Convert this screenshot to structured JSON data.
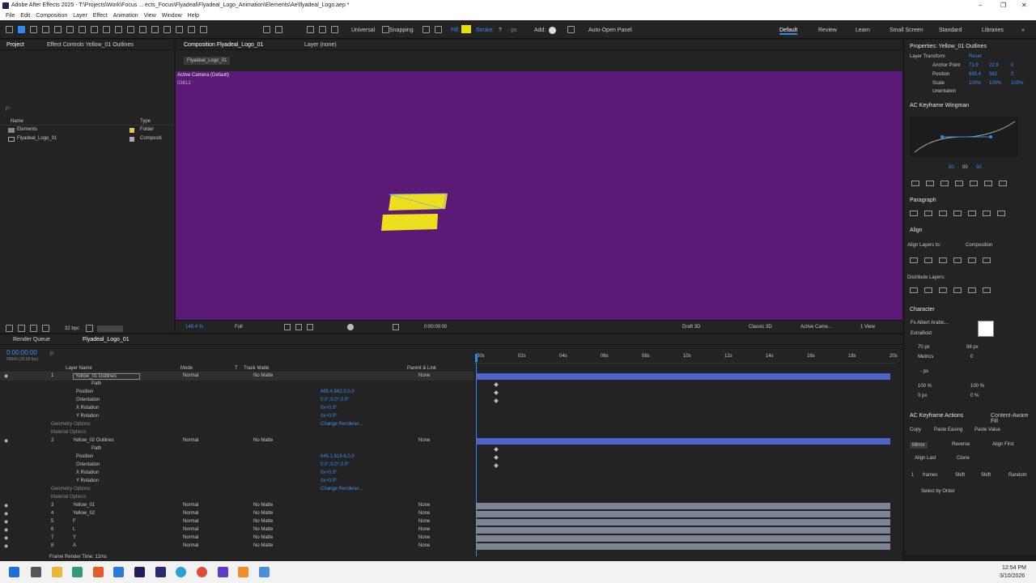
{
  "window": {
    "title": "Adobe After Effects 2025 - T:\\Projects\\Work\\Focus ... ects_Focus\\Flyadeal\\Flyadeal_Logo_Animation\\Elements\\Ae\\flyadeal_Logo.aep *"
  },
  "menu": [
    "File",
    "Edit",
    "Composition",
    "Layer",
    "Effect",
    "Animation",
    "View",
    "Window",
    "Help"
  ],
  "toolbar": {
    "universal": "Universal",
    "snapping": "Snapping",
    "fill": "Fill:",
    "stroke": "Stroke:",
    "stroke_val": "?",
    "px": "- px",
    "add": "Add:",
    "auto_open": "Auto-Open Panel",
    "fill_color": "#e8e000",
    "accent": "#2d8ceb"
  },
  "workspaces": [
    "Default",
    "Review",
    "Learn",
    "Small Screen",
    "Standard",
    "Libraries"
  ],
  "project": {
    "tab": "Project",
    "effect_tab": "Effect Controls Yellow_01 Outlines",
    "search": "ρ~",
    "col_name": "Name",
    "col_type": "Type",
    "items": [
      {
        "name": "Elements",
        "type": "Folder"
      },
      {
        "name": "Flyadeal_Logo_01",
        "type": "Compositi"
      }
    ],
    "bpc": "32 bpc"
  },
  "composition": {
    "tab": "Composition Flyadeal_Logo_01",
    "layer_tab": "Layer (none)",
    "subtab": "Flyadeal_Logo_01",
    "camera": "Active Camera (Default)",
    "code": "03812",
    "bg": "#5a1a75",
    "shape_color": "#ece01c",
    "zoom": "148.4 %",
    "res": "Full",
    "time": "0:00:00:00",
    "renderer": "Draft 3D",
    "classic": "Classic 3D",
    "view_cam": "Active Came...",
    "views": "1 View"
  },
  "properties": {
    "title": "Properties: Yellow_01 Outlines",
    "layer_transform": "Layer Transform",
    "reset": "Reset",
    "rows": [
      {
        "label": "Anchor Point",
        "v1": "71.9",
        "v2": "22.9",
        "v3": "0"
      },
      {
        "label": "Position",
        "v1": "665.4",
        "v2": "562",
        "v3": "0"
      },
      {
        "label": "Scale",
        "v1": "100%",
        "v2": "100%",
        "v3": "100%"
      },
      {
        "label": "Orientation",
        "v1": "",
        "v2": "",
        "v3": ""
      }
    ]
  },
  "wingman": {
    "title": "AC Keyframe Wingman",
    "v1": "50",
    "v2": "00",
    "v3": "50"
  },
  "paragraph": {
    "title": "Paragraph"
  },
  "align": {
    "title": "Align",
    "align_to": "Align Layers to:",
    "target": "Composition",
    "distribute": "Distribute Layers:"
  },
  "character": {
    "title": "Character",
    "font": "Fs Albert Arabic...",
    "weight": "ExtraBold",
    "size": "70 px",
    "leading": "98 px",
    "metrics": "Metrics",
    "tracking": "0",
    "stroke": "- px",
    "hscale": "100 %",
    "vscale": "100 %",
    "baseline": "0 px",
    "tsume": "0 %"
  },
  "actions": {
    "title": "AC Keyframe Actions",
    "content_aware": "Content-Aware Fill",
    "copy": "Copy",
    "paste_easing": "Paste Easing",
    "paste_value": "Paste Value",
    "mirror": "Mirror",
    "reverse": "Reverse",
    "align_first": "Align First",
    "align_last": "Align Last",
    "clone": "Clone",
    "count": "1",
    "frames": "frames",
    "shift1": "Shift",
    "shift2": "Shift",
    "random": "Random",
    "select_order": "Select by Order"
  },
  "timeline": {
    "render_queue": "Render Queue",
    "tab": "Flyadeal_Logo_01",
    "timecode": "0:00:00:00",
    "fps": "00000 (25.00 fps)",
    "col_layer": "Layer Name",
    "col_mode": "Mode",
    "col_t": "T",
    "col_matte": "Track Matte",
    "col_parent": "Parent & Link",
    "ruler": [
      "00s",
      "02s",
      "04s",
      "06s",
      "08s",
      "10s",
      "12s",
      "14s",
      "16s",
      "18s",
      "20s"
    ],
    "footer": "Frame Render Time: 11ms",
    "rows": [
      {
        "num": "1",
        "name": "Yellow_01 Outlines",
        "mode": "Normal",
        "matte": "No Matte",
        "parent": "None",
        "kind": "layer",
        "sel": true
      },
      {
        "num": "",
        "name": "Path",
        "kind": "sub"
      },
      {
        "num": "",
        "name": "Position",
        "val": "665.4,562.0,0.0",
        "kind": "prop"
      },
      {
        "num": "",
        "name": "Orientation",
        "val": "0.0°,0.0°,0.0°",
        "kind": "prop"
      },
      {
        "num": "",
        "name": "X Rotation",
        "val": "0x+0.0°",
        "kind": "prop"
      },
      {
        "num": "",
        "name": "Y Rotation",
        "val": "0x+0.0°",
        "kind": "prop"
      },
      {
        "num": "",
        "name": "Geometry Options",
        "val": "Change Renderer...",
        "kind": "grp"
      },
      {
        "num": "",
        "name": "Material Options",
        "kind": "grp"
      },
      {
        "num": "2",
        "name": "Yellow_02 Outlines",
        "mode": "Normal",
        "matte": "No Matte",
        "parent": "None",
        "kind": "layer"
      },
      {
        "num": "",
        "name": "Path",
        "kind": "sub"
      },
      {
        "num": "",
        "name": "Position",
        "val": "645.1,616.6,0.0",
        "kind": "prop"
      },
      {
        "num": "",
        "name": "Orientation",
        "val": "0.0°,0.0°,0.0°",
        "kind": "prop"
      },
      {
        "num": "",
        "name": "X Rotation",
        "val": "0x+0.0°",
        "kind": "prop"
      },
      {
        "num": "",
        "name": "Y Rotation",
        "val": "0x+0.0°",
        "kind": "prop"
      },
      {
        "num": "",
        "name": "Geometry Options",
        "val": "Change Renderer...",
        "kind": "grp"
      },
      {
        "num": "",
        "name": "Material Options",
        "kind": "grp"
      },
      {
        "num": "3",
        "name": "Yellow_01",
        "mode": "Normal",
        "matte": "No Matte",
        "parent": "None",
        "kind": "layer2"
      },
      {
        "num": "4",
        "name": "Yellow_02",
        "mode": "Normal",
        "matte": "No Matte",
        "parent": "None",
        "kind": "layer2"
      },
      {
        "num": "5",
        "name": "F",
        "mode": "Normal",
        "matte": "No Matte",
        "parent": "None",
        "kind": "layer2"
      },
      {
        "num": "6",
        "name": "L",
        "mode": "Normal",
        "matte": "No Matte",
        "parent": "None",
        "kind": "layer2"
      },
      {
        "num": "7",
        "name": "Y",
        "mode": "Normal",
        "matte": "No Matte",
        "parent": "None",
        "kind": "layer2"
      },
      {
        "num": "8",
        "name": "A",
        "mode": "Normal",
        "matte": "No Matte",
        "parent": "None",
        "kind": "layer2"
      }
    ]
  },
  "taskbar": {
    "time": "12:54 PM",
    "date": "3/10/2026"
  }
}
